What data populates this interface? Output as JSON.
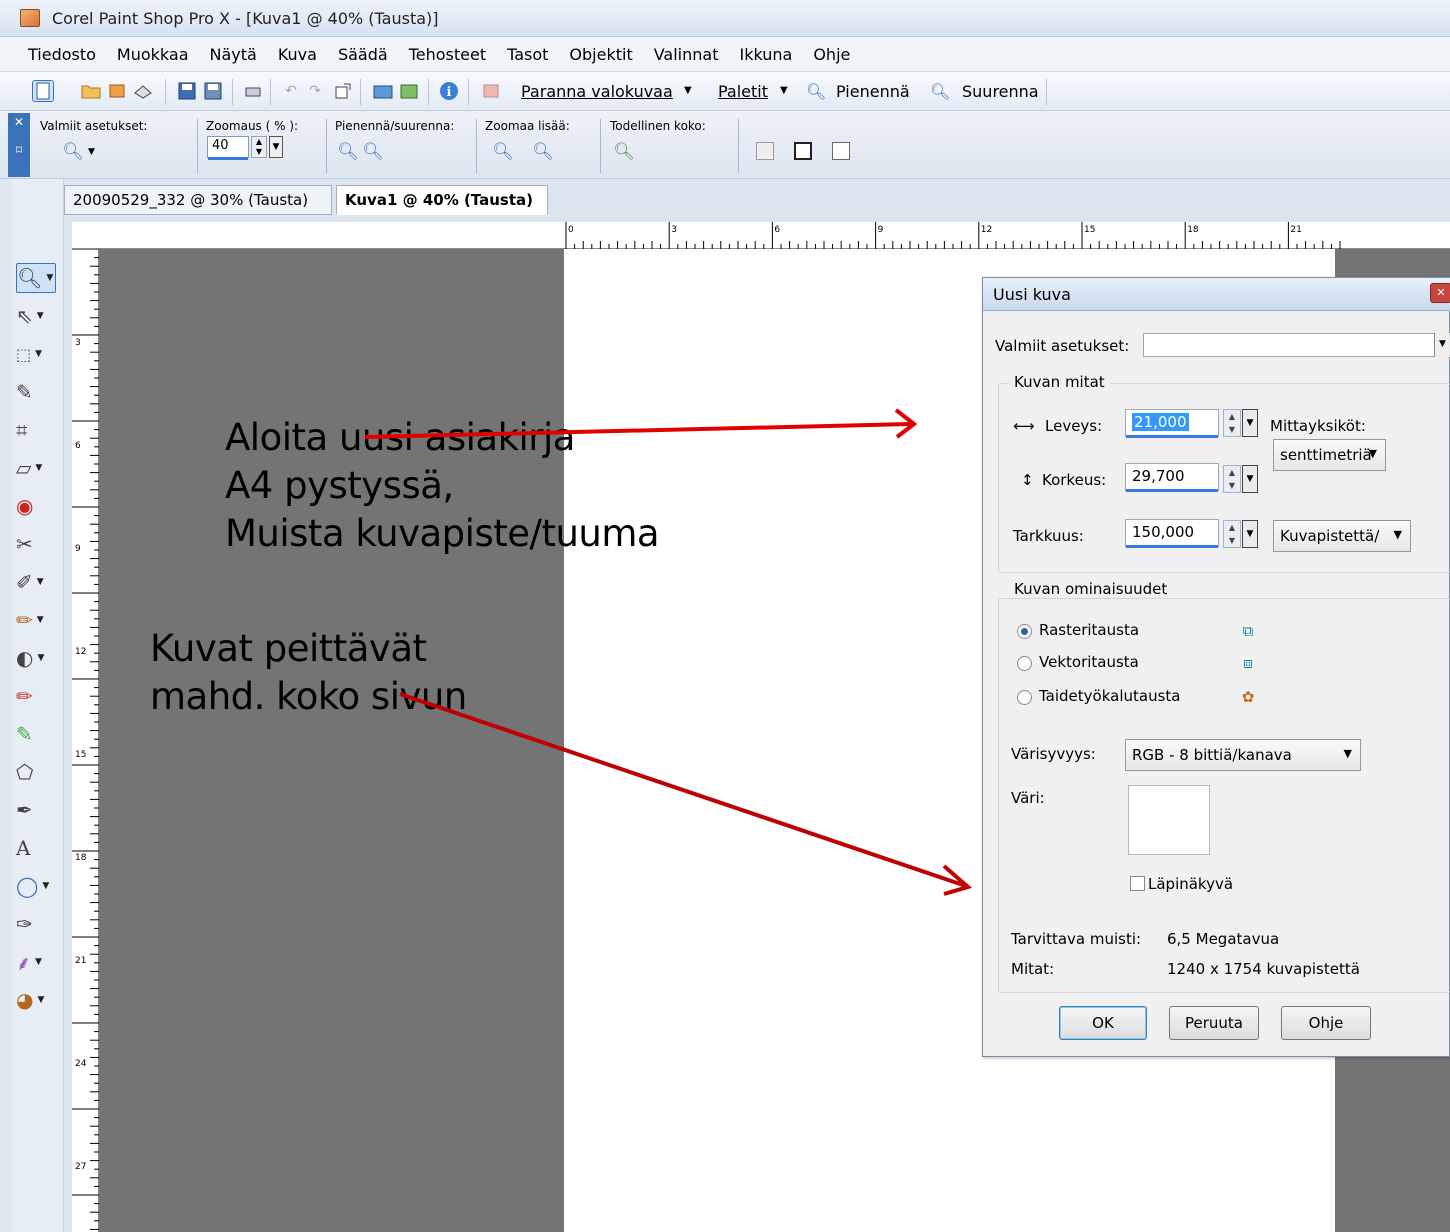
{
  "window": {
    "title": "Corel Paint Shop Pro X - [Kuva1 @ 40% (Tausta)]"
  },
  "menu": [
    "Tiedosto",
    "Muokkaa",
    "Näytä",
    "Kuva",
    "Säädä",
    "Tehosteet",
    "Tasot",
    "Objektit",
    "Valinnat",
    "Ikkuna",
    "Ohje"
  ],
  "toolbar": {
    "enhance_label": "Paranna valokuvaa",
    "palettes_label": "Paletit",
    "zoom_out_label": "Pienennä",
    "zoom_in_label": "Suurenna"
  },
  "zoom_toolbar": {
    "presets_label": "Valmiit asetukset:",
    "zoom_percent_label": "Zoomaus ( % ):",
    "zoom_value": "40",
    "zoom_inout_label": "Pienennä/suurenna:",
    "zoom_more_label": "Zoomaa lisää:",
    "actual_size_label": "Todellinen koko:"
  },
  "tabs": [
    {
      "label": "20090529_332 @ 30% (Tausta)",
      "active": false
    },
    {
      "label": "Kuva1 @ 40% (Tausta)",
      "active": true
    }
  ],
  "ruler": {
    "h_labels": [
      "0",
      "3",
      "6",
      "9",
      "12",
      "15",
      "18",
      "21"
    ],
    "v_labels": [
      "3",
      "6",
      "9",
      "12",
      "15",
      "18",
      "21",
      "24",
      "27"
    ]
  },
  "annotations": {
    "block1": [
      "Aloita uusi asiakirja",
      "A4 pystyssä,",
      "Muista kuvapiste/tuuma"
    ],
    "block2": [
      "Kuvat  peittävät",
      "mahd. koko sivun"
    ],
    "arrow_color": "#e00000",
    "arrow2_color": "#c00000"
  },
  "dialog": {
    "title": "Uusi kuva",
    "presets_label": "Valmiit asetukset:",
    "presets_value": "",
    "dimensions_group": "Kuvan mitat",
    "width_label": "Leveys:",
    "width_value": "21,000",
    "height_label": "Korkeus:",
    "height_value": "29,700",
    "resolution_label": "Tarkkuus:",
    "resolution_value": "150,000",
    "units_label": "Mittayksiköt:",
    "units_value": "senttimetriä",
    "resolution_units_value": "Kuvapistettä/",
    "properties_group": "Kuvan ominaisuudet",
    "bg_options": [
      {
        "label": "Rasteritausta",
        "selected": true,
        "icon": "raster-bg-icon"
      },
      {
        "label": "Vektoritausta",
        "selected": false,
        "icon": "vector-bg-icon"
      },
      {
        "label": "Taidetyökalutausta",
        "selected": false,
        "icon": "art-media-bg-icon"
      }
    ],
    "depth_label": "Värisyvyys:",
    "depth_value": "RGB - 8 bittiä/kanava",
    "color_label": "Väri:",
    "color_value": "#ffffff",
    "transparent_label": "Läpinäkyvä",
    "transparent_checked": false,
    "memory_label": "Tarvittava muisti:",
    "memory_value": "6,5 Megatavua",
    "dimensions_label": "Mitat:",
    "dimensions_value": "1240 x 1754 kuvapistettä",
    "ok_label": "OK",
    "cancel_label": "Peruuta",
    "help_label": "Ohje"
  }
}
